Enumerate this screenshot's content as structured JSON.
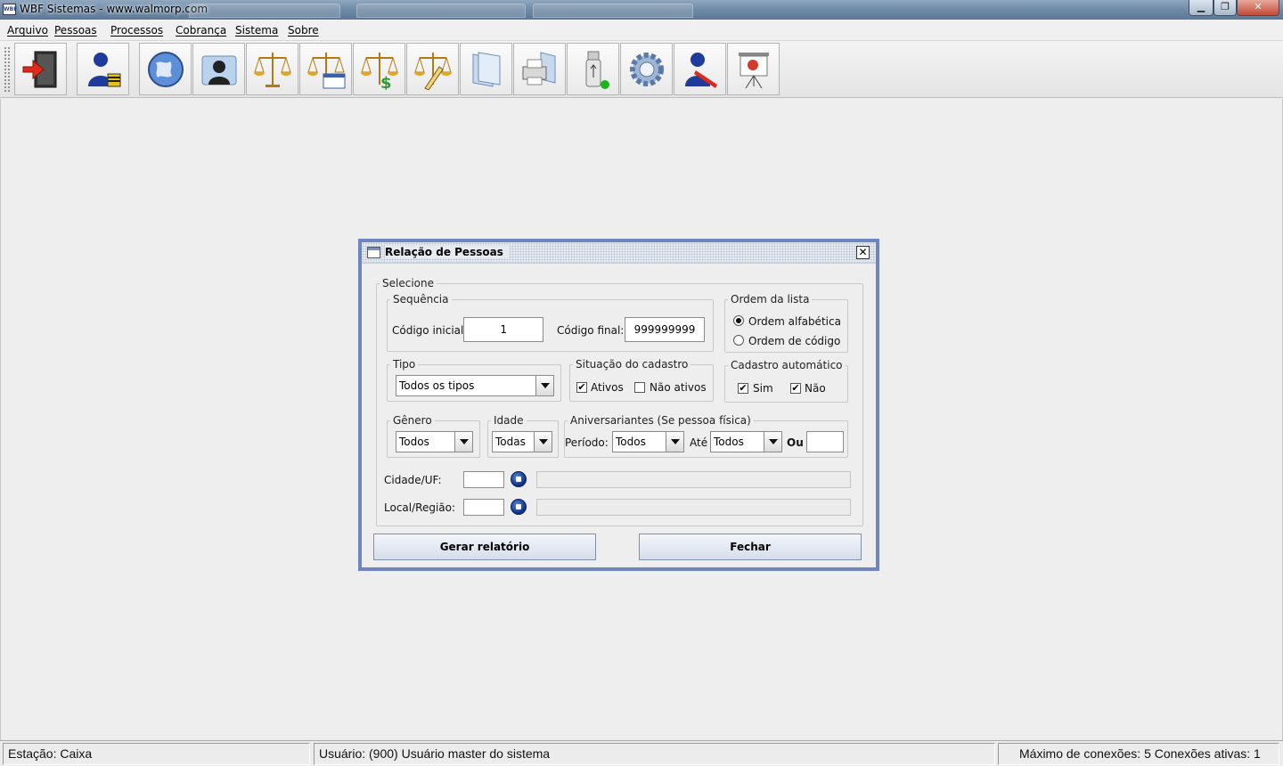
{
  "window": {
    "title": "WBF Sistemas - www.walmorp.com",
    "app_icon": "wbf-logo-icon",
    "controls": {
      "minimize": "minimize-icon",
      "maximize": "restore-icon",
      "close": "close-icon"
    }
  },
  "menu": [
    {
      "label": "Arquivo"
    },
    {
      "label": "Pessoas"
    },
    {
      "label": "Processos"
    },
    {
      "label": "Cobrança"
    },
    {
      "label": "Sistema"
    },
    {
      "label": "Sobre"
    }
  ],
  "toolbar": [
    {
      "icon": "exit-door-icon"
    },
    {
      "icon": "user-lock-icon"
    },
    {
      "icon": "globe-icon"
    },
    {
      "icon": "contact-folder-icon"
    },
    {
      "icon": "balance-scale-icon"
    },
    {
      "icon": "balance-scale-window-icon"
    },
    {
      "icon": "balance-scale-money-icon"
    },
    {
      "icon": "balance-scale-edit-icon"
    },
    {
      "icon": "folder-icon"
    },
    {
      "icon": "printer-icon"
    },
    {
      "icon": "usb-drive-icon"
    },
    {
      "icon": "settings-gear-icon"
    },
    {
      "icon": "user-edit-icon"
    },
    {
      "icon": "presentation-icon"
    }
  ],
  "dialog": {
    "title": "Relação de Pessoas",
    "selecione_legend": "Selecione",
    "sequencia": {
      "legend": "Sequência",
      "codigo_inicial_label": "Código inicial:",
      "codigo_inicial_value": "1",
      "codigo_final_label": "Código final:",
      "codigo_final_value": "999999999"
    },
    "ordem": {
      "legend": "Ordem da lista",
      "options": [
        {
          "label": "Ordem alfabética",
          "selected": true
        },
        {
          "label": "Ordem de código",
          "selected": false
        }
      ]
    },
    "tipo": {
      "legend": "Tipo",
      "value": "Todos os tipos"
    },
    "situacao": {
      "legend": "Situação do cadastro",
      "ativos_label": "Ativos",
      "ativos_checked": true,
      "nao_ativos_label": "Não ativos",
      "nao_ativos_checked": false
    },
    "cadastro_auto": {
      "legend": "Cadastro automático",
      "sim_label": "Sim",
      "sim_checked": true,
      "nao_label": "Não",
      "nao_checked": true
    },
    "genero": {
      "legend": "Gênero",
      "value": "Todos"
    },
    "idade": {
      "legend": "Idade",
      "value": "Todas"
    },
    "aniversariantes": {
      "legend": "Aniversariantes (Se pessoa física)",
      "periodo_label": "Período:",
      "periodo_value": "Todos",
      "ate_label": "Até",
      "ate_value": "Todos",
      "ou_label": "Ou",
      "ou_value": ""
    },
    "cidade_label": "Cidade/UF:",
    "cidade_value": "",
    "local_label": "Local/Região:",
    "local_value": "",
    "gerar_label": "Gerar relatório",
    "fechar_label": "Fechar"
  },
  "status": {
    "estacao": "Estação: Caixa",
    "usuario": "Usuário: (900) Usuário master do sistema",
    "conexoes": "Máximo de conexões: 5 Conexões ativas: 1"
  },
  "colors": {
    "dialog_border": "#6d86c0",
    "background": "#eeeeee",
    "accent_blue": "#0b2e83"
  }
}
